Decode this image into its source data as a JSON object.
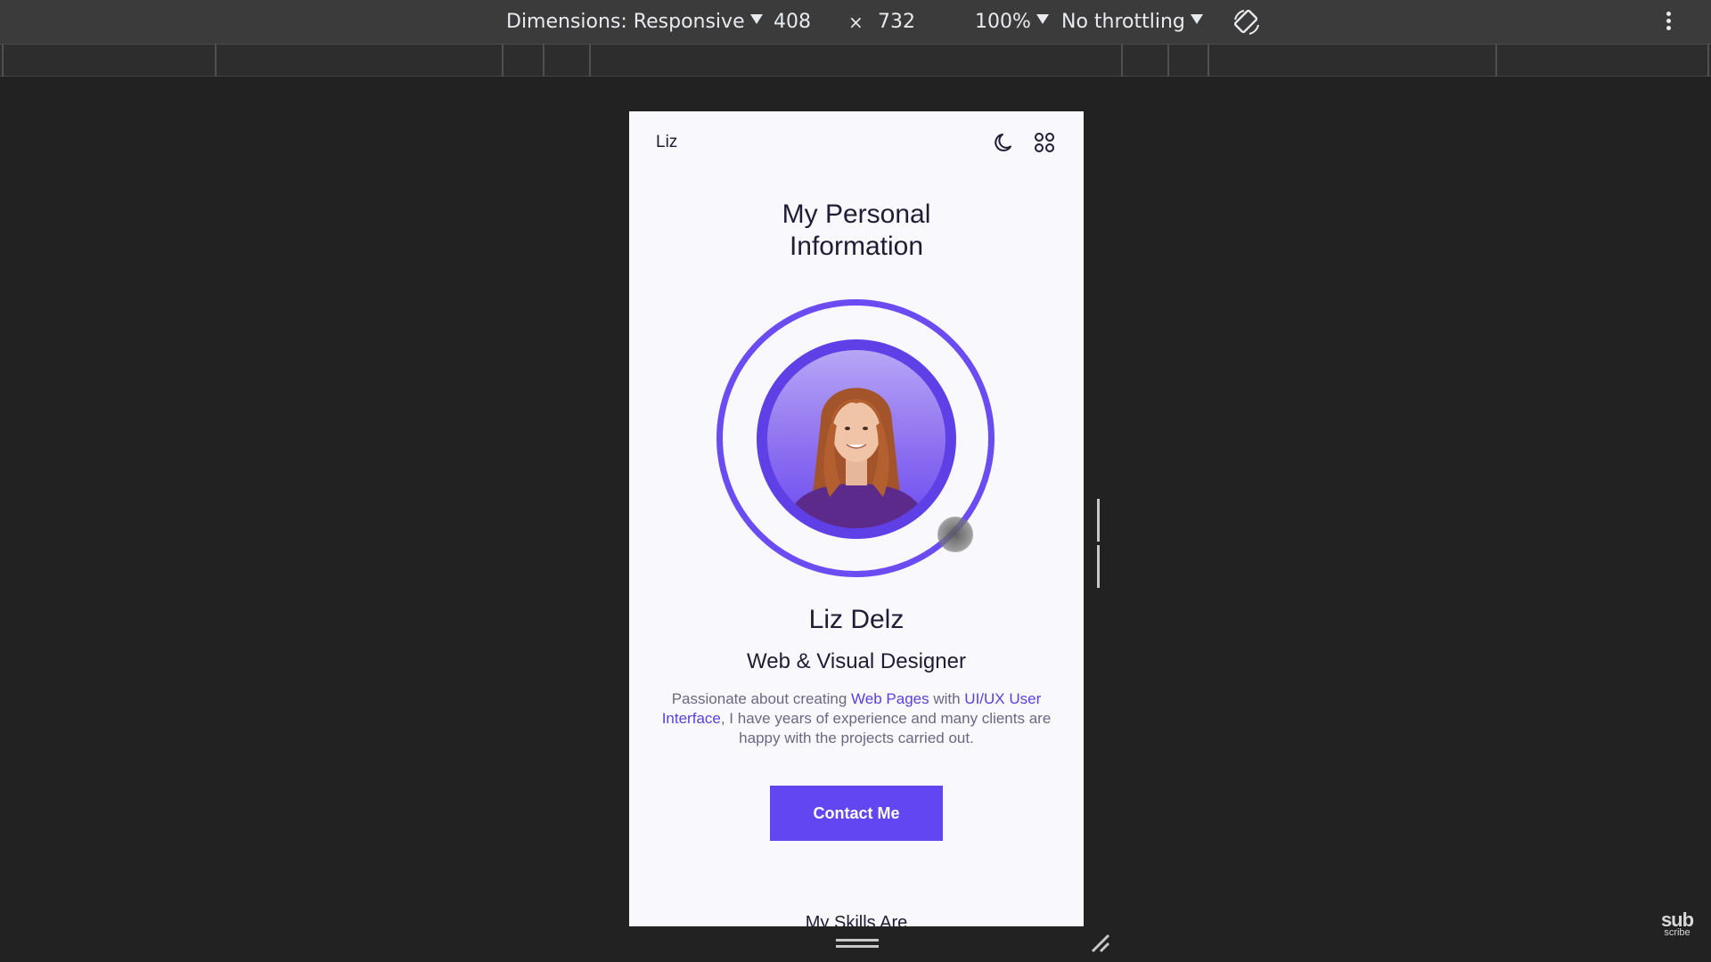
{
  "devtools": {
    "dimensions_label": "Dimensions: Responsive",
    "width": "408",
    "times": "×",
    "height": "732",
    "zoom": "100%",
    "throttling": "No throttling",
    "rotate_icon": "rotate-icon",
    "more_icon": "more-vertical-icon"
  },
  "page": {
    "logo": "Liz",
    "theme_icon": "moon-icon",
    "menu_icon": "grid-menu-icon",
    "title_line1": "My Personal",
    "title_line2": "Information",
    "name": "Liz Delz",
    "role": "Web & Visual Designer",
    "description": {
      "part1": "Passionate about creating ",
      "link1": "Web Pages",
      "part2": " with ",
      "link2": "UI/UX User Interface",
      "part3": ", I have years of experience and many clients are happy with the projects carried out."
    },
    "contact_button": "Contact Me",
    "skills_heading": "My Skills Are"
  },
  "watermark": {
    "line1": "sub",
    "line2": "scribe"
  },
  "colors": {
    "accent": "#6146f2",
    "devtools_bg": "#222222",
    "page_bg": "#f9f8fd"
  }
}
